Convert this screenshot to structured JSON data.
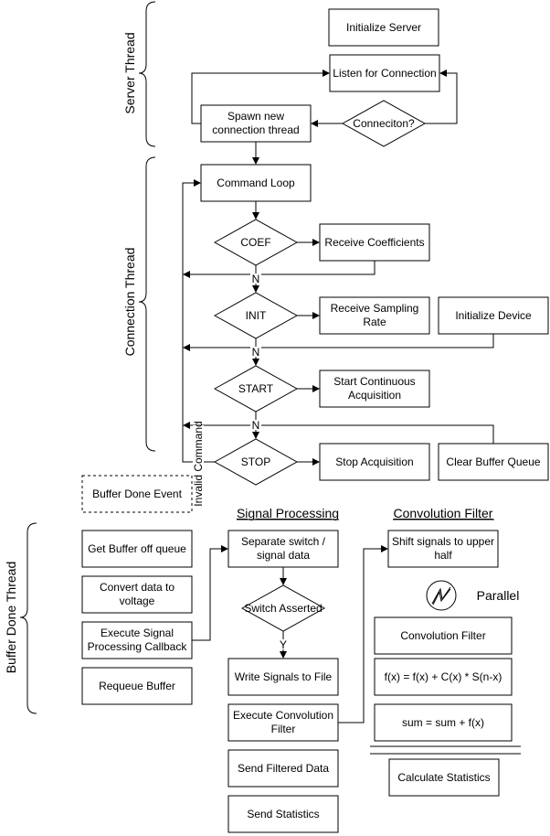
{
  "threads": {
    "server": "Server Thread",
    "connection": "Connection Thread",
    "buffer_done": "Buffer Done Thread"
  },
  "server": {
    "init": "Initialize Server",
    "listen": "Listen for Connection",
    "spawn": [
      "Spawn new",
      "connection thread"
    ],
    "decision": "Conneciton?"
  },
  "connection": {
    "loop": "Command Loop",
    "coef": "COEF",
    "recv_coef": "Receive Coefficients",
    "init": "INIT",
    "recv_rate": [
      "Receive Sampling",
      "Rate"
    ],
    "init_device": "Initialize Device",
    "start": "START",
    "start_acq": [
      "Start Continuous",
      "Acquisition"
    ],
    "stop": "STOP",
    "stop_acq": "Stop Acquisition",
    "clear_queue": "Clear Buffer Queue",
    "no_label": "N",
    "invalid": "Invalid Command"
  },
  "buffer": {
    "event": "Buffer Done Event",
    "get": "Get Buffer off queue",
    "convert": [
      "Convert data to",
      "voltage"
    ],
    "exec_sp": [
      "Execute Signal",
      "Processing Callback"
    ],
    "requeue": "Requeue Buffer"
  },
  "signal": {
    "title": "Signal Processing",
    "separate": [
      "Separate switch /",
      "signal data"
    ],
    "switch": "Switch Asserted",
    "yes_label": "Y",
    "write": "Write Signals to File",
    "exec_conv": [
      "Execute Convolution",
      "Filter"
    ],
    "send_filtered": "Send Filtered Data",
    "send_stats": "Send Statistics"
  },
  "conv": {
    "title": "Convolution Filter",
    "shift": [
      "Shift signals to upper",
      "half"
    ],
    "parallel": "Parallel",
    "parallel_icon": "lightning-bolt-circle",
    "filter": "Convolution Filter",
    "formula": "f(x) = f(x) + C(x) * S(n-x)",
    "sum": "sum = sum + f(x)",
    "stats": "Calculate Statistics"
  }
}
